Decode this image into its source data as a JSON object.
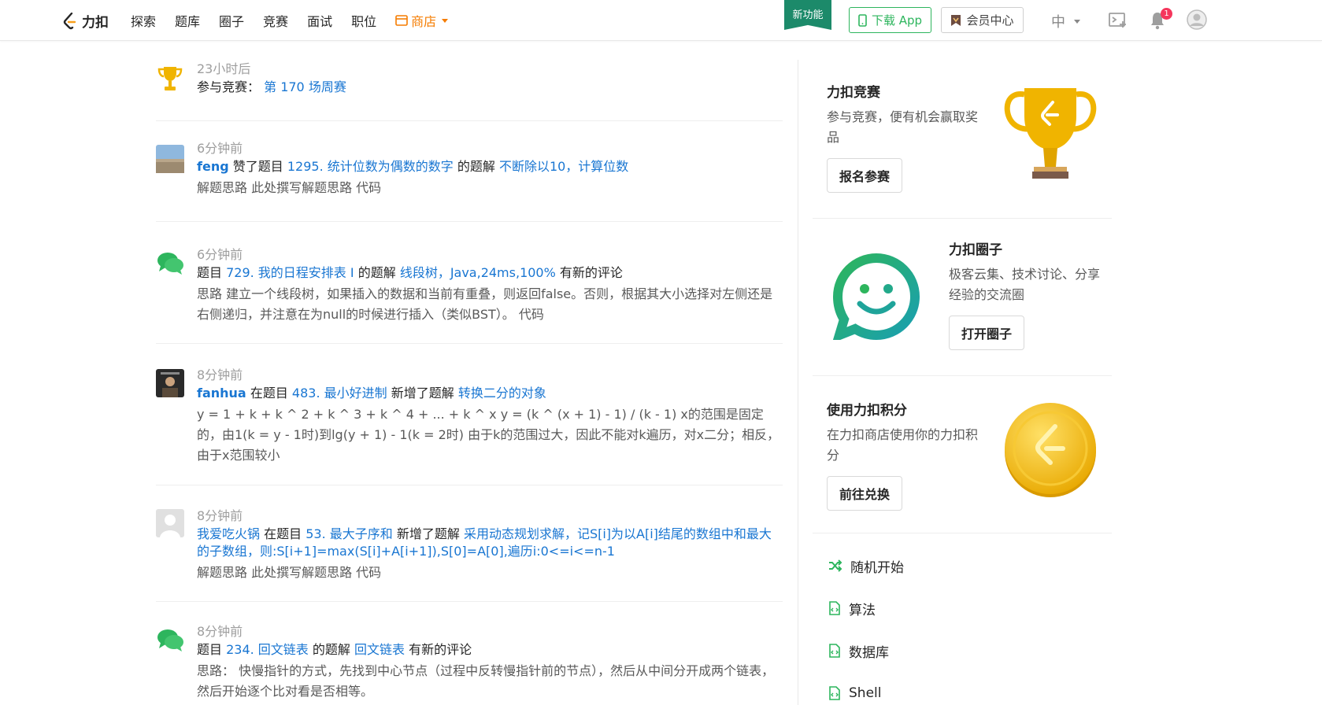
{
  "nav": {
    "logo_text": "力扣",
    "links": [
      "探索",
      "题库",
      "圈子",
      "竞赛",
      "面试",
      "职位"
    ],
    "store_label": "商店",
    "new_feature": "新功能",
    "download_app": "下载 App",
    "vip_center": "会员中心",
    "language": "中",
    "notification_count": "1"
  },
  "feed": [
    {
      "time": "23小时后",
      "prefix": "参与竞赛：",
      "contest_link": "第 170 场周赛"
    },
    {
      "time": "6分钟前",
      "user": "feng",
      "text1": " 赞了题目 ",
      "problem": "1295. 统计位数为偶数的数字",
      "text2": " 的题解 ",
      "solution": "不断除以10，计算位数",
      "desc": "解题思路 此处撰写解题思路 代码"
    },
    {
      "time": "6分钟前",
      "text0": "题目 ",
      "problem": "729. 我的日程安排表 I",
      "text1": " 的题解 ",
      "solution": "线段树，Java,24ms,100%",
      "text2": " 有新的评论",
      "desc": "思路 建立一个线段树，如果插入的数据和当前有重叠，则返回false。否则，根据其大小选择对左侧还是右侧递归，并注意在为null的时候进行插入（类似BST）。 代码"
    },
    {
      "time": "8分钟前",
      "user": "fanhua",
      "text1": " 在题目 ",
      "problem": "483. 最小好进制",
      "text2": " 新增了题解 ",
      "solution": "转换二分的对象",
      "desc": "y = 1 + k + k ^ 2 + k ^ 3 + k ^ 4 + ... + k ^ x y = (k ^ (x + 1) - 1) / (k - 1) x的范围是固定的，由1(k = y - 1时)到lg(y + 1) - 1(k = 2时) 由于k的范围过大，因此不能对k遍历，对x二分；相反，由于x范围较小"
    },
    {
      "time": "8分钟前",
      "user": "我爱吃火锅",
      "text1": " 在题目 ",
      "problem": "53. 最大子序和",
      "text2": " 新增了题解 ",
      "solution": "采用动态规划求解，记S[i]为以A[i]结尾的数组中和最大的子数组，则:S[i+1]=max(S[i]+A[i+1]),S[0]=A[0],遍历i:0<=i<=n-1",
      "desc": "解题思路 此处撰写解题思路 代码"
    },
    {
      "time": "8分钟前",
      "text0": "题目 ",
      "problem": "234. 回文链表",
      "text1": " 的题解 ",
      "solution": "回文链表",
      "text2": " 有新的评论",
      "desc": "思路： 快慢指针的方式，先找到中心节点（过程中反转慢指针前的节点），然后从中间分开成两个链表，然后开始逐个比对看是否相等。"
    }
  ],
  "sidebar": {
    "contest": {
      "title": "力扣竞赛",
      "desc": "参与竞赛，便有机会赢取奖品",
      "button": "报名参赛"
    },
    "circle": {
      "title": "力扣圈子",
      "desc": "极客云集、技术讨论、分享经验的交流圈",
      "button": "打开圈子"
    },
    "points": {
      "title": "使用力扣积分",
      "desc": "在力扣商店使用你的力扣积分",
      "button": "前往兑换"
    },
    "quick_links": [
      "随机开始",
      "算法",
      "数据库",
      "Shell"
    ]
  },
  "colors": {
    "link": "#1976d2",
    "green": "#2db55d",
    "store": "#f57c00",
    "badge": "#f5365c",
    "trophy": "#f0b400"
  }
}
